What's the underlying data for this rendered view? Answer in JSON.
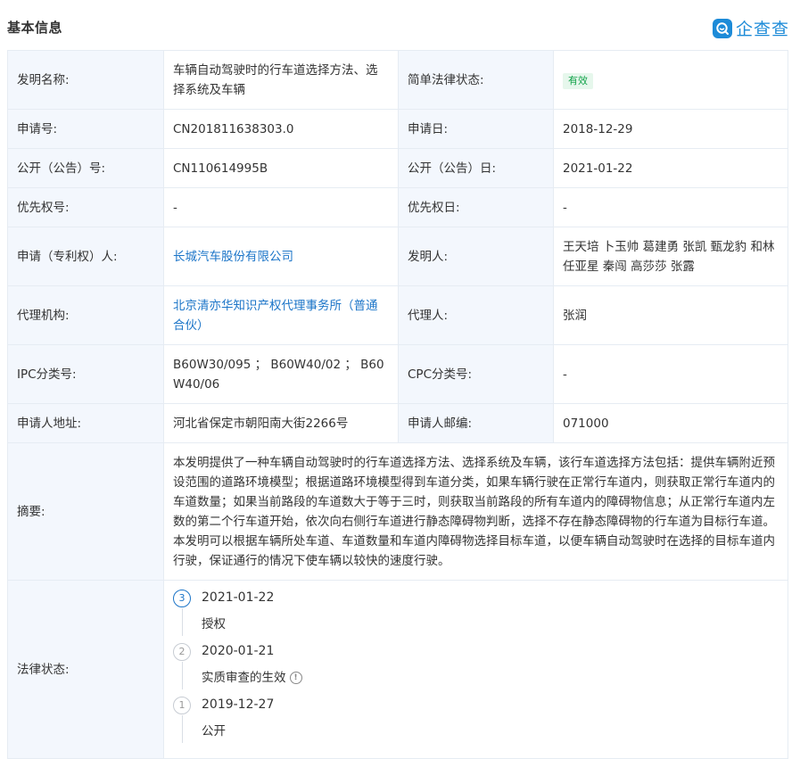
{
  "header": {
    "title": "基本信息",
    "logo_text": "企查查",
    "logo_icon": "qcc-logo-icon"
  },
  "colors": {
    "label_bg": "#f3f7fd",
    "border": "#e6ecf3",
    "link": "#1c75c8",
    "badge_bg": "#e6f7ec",
    "badge_text": "#12a34a",
    "brand": "#1d8bd8"
  },
  "rows": {
    "invention_name": {
      "label": "发明名称:",
      "value": "车辆自动驾驶时的行车道选择方法、选择系统及车辆"
    },
    "legal_status_simple": {
      "label": "简单法律状态:",
      "value": "有效"
    },
    "app_no": {
      "label": "申请号:",
      "value": "CN201811638303.0"
    },
    "app_date": {
      "label": "申请日:",
      "value": "2018-12-29"
    },
    "pub_no": {
      "label": "公开（公告）号:",
      "value": "CN110614995B"
    },
    "pub_date": {
      "label": "公开（公告）日:",
      "value": "2021-01-22"
    },
    "priority_no": {
      "label": "优先权号:",
      "value": "-"
    },
    "priority_date": {
      "label": "优先权日:",
      "value": "-"
    },
    "applicant": {
      "label": "申请（专利权）人:",
      "value": "长城汽车股份有限公司"
    },
    "inventor": {
      "label": "发明人:",
      "value": "王天培 卜玉帅 葛建勇 张凯 甄龙豹 和林 任亚星 秦闯 高莎莎 张露"
    },
    "agency": {
      "label": "代理机构:",
      "value": "北京清亦华知识产权代理事务所（普通合伙）"
    },
    "agent": {
      "label": "代理人:",
      "value": "张润"
    },
    "ipc": {
      "label": "IPC分类号:",
      "value": "B60W30/095 ； B60W40/02 ； B60W40/06"
    },
    "cpc": {
      "label": "CPC分类号:",
      "value": "-"
    },
    "address": {
      "label": "申请人地址:",
      "value": "河北省保定市朝阳南大街2266号"
    },
    "postcode": {
      "label": "申请人邮编:",
      "value": "071000"
    },
    "abstract": {
      "label": "摘要:",
      "value": "本发明提供了一种车辆自动驾驶时的行车道选择方法、选择系统及车辆，该行车道选择方法包括：提供车辆附近预设范围的道路环境模型；根据道路环境模型得到车道分类，如果车辆行驶在正常行车道内，则获取正常行车道内的车道数量；如果当前路段的车道数大于等于三时，则获取当前路段的所有车道内的障碍物信息；从正常行车道内左数的第二个行车道开始，依次向右侧行车道进行静态障碍物判断，选择不存在静态障碍物的行车道为目标行车道。本发明可以根据车辆所处车道、车道数量和车道内障碍物选择目标车道，以便车辆自动驾驶时在选择的目标车道内行驶，保证通行的情况下使车辆以较快的速度行驶。"
    },
    "legal_status": {
      "label": "法律状态:"
    }
  },
  "timeline": [
    {
      "step": "3",
      "date": "2021-01-22",
      "status": "授权",
      "active": true,
      "info": false
    },
    {
      "step": "2",
      "date": "2020-01-21",
      "status": "实质审查的生效",
      "active": false,
      "info": true
    },
    {
      "step": "1",
      "date": "2019-12-27",
      "status": "公开",
      "active": false,
      "info": false
    }
  ]
}
